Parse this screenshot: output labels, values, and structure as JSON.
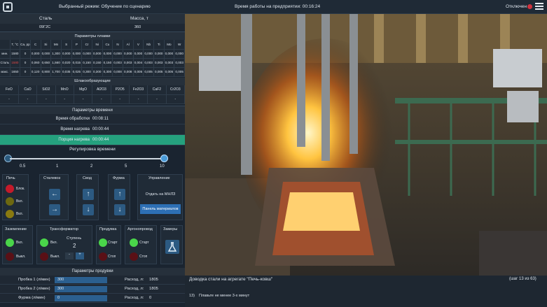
{
  "topbar": {
    "mode": "Выбранный режим: Обучение по сценарию",
    "uptime": "Время работы на предприятии: 00:16:24",
    "connection": "Отключен"
  },
  "steel": {
    "head_steel": "Сталь",
    "head_mass": "Масса, т",
    "steel_grade": "09Г2С",
    "mass": "360"
  },
  "melt": {
    "title": "Параметры плавки",
    "t_header": "T, °C",
    "c_header": "Cа, ppm",
    "columns": [
      "C",
      "Si",
      "Mn",
      "S",
      "P",
      "Cr",
      "Ni",
      "Cu",
      "N",
      "Al",
      "V",
      "Nb",
      "Ti",
      "Mo",
      "W"
    ],
    "rows": [
      {
        "label": "мин.",
        "t": "1580",
        "ca": "0",
        "values": [
          "0,000",
          "0,000",
          "1,300",
          "0,000",
          "0,000",
          "0,000",
          "0,000",
          "0,000",
          "0,000",
          "0,000",
          "0,000",
          "0,000",
          "0,000",
          "0,000",
          "0,000"
        ]
      },
      {
        "label": "Сталь",
        "t": "1580",
        "ca": "0",
        "values": [
          "0,060",
          "0,650",
          "1,560",
          "0,020",
          "0,015",
          "0,150",
          "0,150",
          "0,150",
          "0,003",
          "0,003",
          "0,004",
          "0,003",
          "0,003",
          "0,003",
          "0,003"
        ]
      },
      {
        "label": "макс.",
        "t": "1650",
        "ca": "0",
        "values": [
          "0,120",
          "0,800",
          "1,700",
          "0,035",
          "0,025",
          "0,300",
          "0,300",
          "0,300",
          "0,008",
          "0,008",
          "0,005",
          "0,005",
          "0,005",
          "0,005",
          "0,005"
        ]
      }
    ]
  },
  "slag": {
    "title": "Шлакообразующие",
    "columns": [
      "FeO",
      "CaO",
      "SiO2",
      "MnO",
      "MgO",
      "Al2O3",
      "P2O5",
      "Fe2O3",
      "CaF2",
      "Cr2O3"
    ],
    "values": [
      "-",
      "-",
      "-",
      "-",
      "-",
      "-",
      "-",
      "-",
      "-",
      "-"
    ]
  },
  "time": {
    "title": "Параметры времени",
    "rows": [
      {
        "label": "Время обработки",
        "value": "00:08:11"
      },
      {
        "label": "Время нагрева",
        "value": "00:00:44"
      },
      {
        "label": "Порция нагрева",
        "value": "00:00:44"
      }
    ]
  },
  "regulation": {
    "title": "Регулировка времени",
    "ticks": [
      "0.5",
      "1",
      "2",
      "5",
      "10"
    ],
    "selected_index": 4
  },
  "controls": {
    "furnace": {
      "title": "Печь",
      "items": [
        "Блок.",
        "Вкл.",
        "Вкл."
      ]
    },
    "carriage": {
      "title": "Сталевоз"
    },
    "vault": {
      "title": "Свод"
    },
    "tuyere": {
      "title": "Фурма"
    },
    "control": {
      "title": "Управление",
      "btn1": "Отдать на МНЛЗ",
      "btn2": "Панель материалов"
    },
    "grounding": {
      "title": "Заземление",
      "on": "Вкл.",
      "off": "Выкл."
    },
    "transformer": {
      "title": "Трансформатор",
      "step_label": "Ступень",
      "step": "2",
      "on": "Вкл.",
      "off": "Выкл."
    },
    "purge": {
      "title": "Продувка",
      "start": "Старт",
      "stop": "Стоп"
    },
    "argon": {
      "title": "Аргонопровод",
      "start": "Старт",
      "stop": "Стоп"
    },
    "measure": {
      "title": "Замеры"
    }
  },
  "blowing": {
    "title": "Параметры продувки",
    "rows": [
      {
        "label": "Пробка 1 (л/мин)",
        "value": "300",
        "rate_label": "Расход, л:",
        "rate": "1805"
      },
      {
        "label": "Пробка 2 (л/мин)",
        "value": "300",
        "rate_label": "Расход, л:",
        "rate": "1805"
      },
      {
        "label": "Фурма (л/мин)",
        "value": "0",
        "rate_label": "Расход, л:",
        "rate": "0"
      }
    ]
  },
  "task": {
    "title": "Доводка стали на агрегате \"Печь-ковш\"",
    "step": "(шаг 13 из 63)",
    "num": "13)",
    "instruction": "Плавьте не менее 3-х минут"
  },
  "colors": {
    "accent": "#25a17e",
    "alert": "#d0323e",
    "primary": "#2d6fb4"
  }
}
